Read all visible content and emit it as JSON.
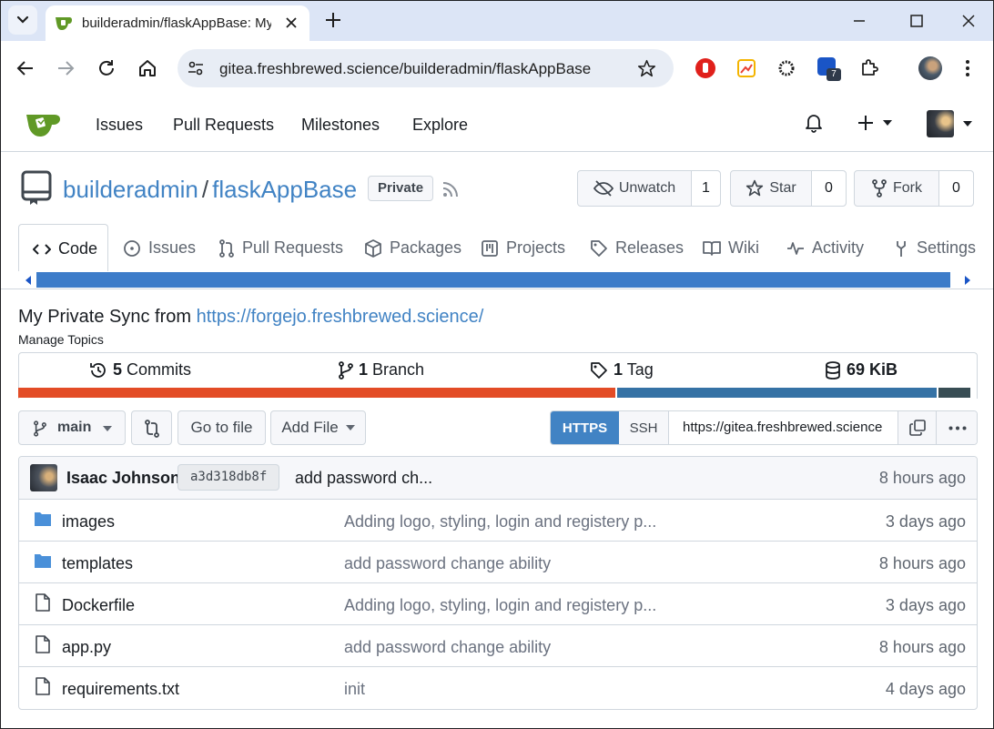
{
  "browser": {
    "tab_title": "builderadmin/flaskAppBase: My",
    "url": "gitea.freshbrewed.science/builderadmin/flaskAppBase",
    "extension_badge": "7"
  },
  "topnav": {
    "items": [
      "Issues",
      "Pull Requests",
      "Milestones",
      "Explore"
    ]
  },
  "repo": {
    "owner": "builderadmin",
    "separator": "/",
    "name": "flaskAppBase",
    "visibility": "Private",
    "unwatch_label": "Unwatch",
    "watch_count": "1",
    "star_label": "Star",
    "star_count": "0",
    "fork_label": "Fork",
    "fork_count": "0",
    "description_prefix": "My Private Sync from",
    "description_link": "https://forgejo.freshbrewed.science/",
    "manage_topics": "Manage Topics"
  },
  "tabs": [
    {
      "label": "Code"
    },
    {
      "label": "Issues"
    },
    {
      "label": "Pull Requests"
    },
    {
      "label": "Packages"
    },
    {
      "label": "Projects"
    },
    {
      "label": "Releases"
    },
    {
      "label": "Wiki"
    },
    {
      "label": "Activity"
    },
    {
      "label": "Settings"
    }
  ],
  "stats": {
    "commits_num": "5",
    "commits_label": "Commits",
    "branch_num": "1",
    "branch_label": "Branch",
    "tag_num": "1",
    "tag_label": "Tag",
    "size": "69 KiB"
  },
  "language_bar": [
    {
      "color": "#e34c26",
      "fraction": 0.625
    },
    {
      "color": "#3572a5",
      "fraction": 0.334
    },
    {
      "color": "#384d54",
      "fraction": 0.033
    }
  ],
  "toolbar": {
    "branch": "main",
    "go_to_file": "Go to file",
    "add_file": "Add File",
    "https": "HTTPS",
    "ssh": "SSH",
    "clone_url": "https://gitea.freshbrewed.science"
  },
  "latest_commit": {
    "author": "Isaac Johnson",
    "sha": "a3d318db8f",
    "message": "add password ch...",
    "age": "8 hours ago"
  },
  "files": [
    {
      "name": "images",
      "type": "folder",
      "message": "Adding logo, styling, login and registery p...",
      "age": "3 days ago"
    },
    {
      "name": "templates",
      "type": "folder",
      "message": "add password change ability",
      "age": "8 hours ago"
    },
    {
      "name": "Dockerfile",
      "type": "file",
      "message": "Adding logo, styling, login and registery p...",
      "age": "3 days ago"
    },
    {
      "name": "app.py",
      "type": "file",
      "message": "add password change ability",
      "age": "8 hours ago"
    },
    {
      "name": "requirements.txt",
      "type": "file",
      "message": "init",
      "age": "4 days ago"
    }
  ],
  "colors": {
    "link": "#4183c4",
    "primary": "#4183c4",
    "chrome_bg": "#dce5f6"
  }
}
